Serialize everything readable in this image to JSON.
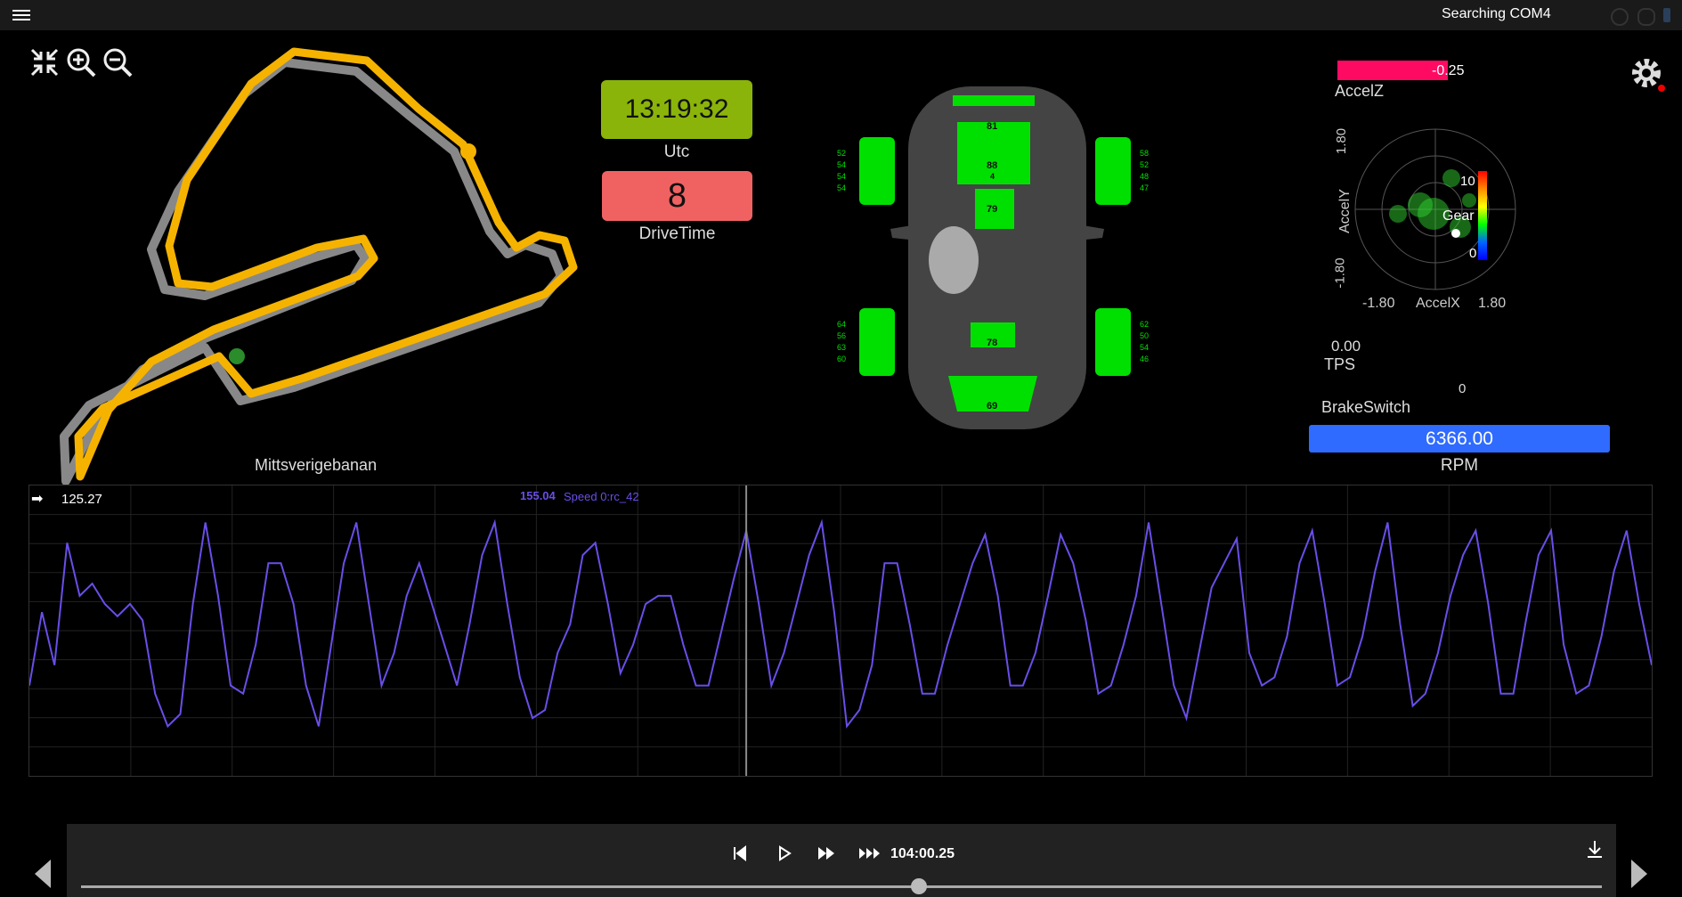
{
  "status": {
    "text": "Searching COM4"
  },
  "map": {
    "track_name": "Mittsverigebanan"
  },
  "utc": {
    "value": "13:19:32",
    "label": "Utc",
    "color": "#8bb40a"
  },
  "drivetime": {
    "value": "8",
    "label": "DriveTime",
    "color": "#f06262"
  },
  "car": {
    "front_left_temps": [
      "52",
      "54",
      "54",
      "54"
    ],
    "front_right_temps": [
      "58",
      "52",
      "48",
      "47"
    ],
    "rear_left_temps": [
      "64",
      "56",
      "63",
      "60"
    ],
    "rear_right_temps": [
      "62",
      "50",
      "54",
      "46"
    ],
    "engine_top": "81",
    "engine_mid": "88",
    "engine_small": "4",
    "gearbox": "79",
    "diff": "78",
    "rear_tank": "69",
    "accent": "#00e000"
  },
  "accelz": {
    "value": "-0.25",
    "label": "AccelZ",
    "color": "#ff0a62"
  },
  "gg": {
    "yaxis_top": "1.80",
    "yaxis_label": "AccelY",
    "yaxis_bottom": "-1.80",
    "xaxis_left": "-1.80",
    "xaxis_label": "AccelX",
    "xaxis_right": "1.80",
    "scale_top": "10",
    "scale_bottom": "0",
    "scale_label": "Gear"
  },
  "tps": {
    "value": "0.00",
    "label": "TPS"
  },
  "brake": {
    "label": "BrakeSwitch",
    "value": "0"
  },
  "rpm": {
    "value": "6366.00",
    "label": "RPM",
    "color": "#2f6bff"
  },
  "chart_header": {
    "left_value": "125.27",
    "cursor_value": "155.04",
    "channel": "Speed 0:rc_42"
  },
  "transport": {
    "time": "104:00.25",
    "position_fraction": 0.551
  },
  "icons": {
    "menu": "menu-icon",
    "fit": "fit-to-view-icon",
    "zoom_in": "zoom-in-icon",
    "zoom_out": "zoom-out-icon",
    "settings": "gear-icon",
    "skip_start": "skip-to-start-icon",
    "play": "play-icon",
    "ff": "fast-forward-icon",
    "fff": "faster-forward-icon",
    "download": "download-icon"
  },
  "chart_data": {
    "type": "line",
    "series": [
      {
        "name": "Speed 0:rc_42",
        "color": "#6a4ee8",
        "values": [
          40,
          58,
          45,
          75,
          62,
          65,
          60,
          57,
          60,
          56,
          38,
          30,
          33,
          60,
          80,
          62,
          40,
          38,
          50,
          70,
          70,
          60,
          40,
          30,
          50,
          70,
          80,
          60,
          40,
          48,
          62,
          70,
          60,
          50,
          40,
          55,
          72,
          80,
          60,
          42,
          32,
          34,
          48,
          55,
          72,
          75,
          60,
          43,
          50,
          60,
          62,
          62,
          50,
          40,
          40,
          53,
          66,
          78,
          60,
          40,
          48,
          60,
          72,
          80,
          58,
          30,
          34,
          45,
          70,
          70,
          55,
          38,
          38,
          50,
          60,
          70,
          77,
          62,
          40,
          40,
          48,
          62,
          77,
          70,
          56,
          38,
          40,
          50,
          62,
          80,
          60,
          40,
          32,
          48,
          64,
          70,
          76,
          48,
          40,
          42,
          52,
          70,
          78,
          60,
          40,
          42,
          52,
          68,
          80,
          55,
          35,
          38,
          48,
          62,
          72,
          78,
          60,
          38,
          38,
          56,
          72,
          78,
          50,
          38,
          40,
          52,
          68,
          78,
          60,
          45
        ]
      }
    ],
    "xlim": [
      0,
      129
    ],
    "ylim": [
      0,
      100
    ],
    "cursor_index": 57,
    "grid": true
  }
}
